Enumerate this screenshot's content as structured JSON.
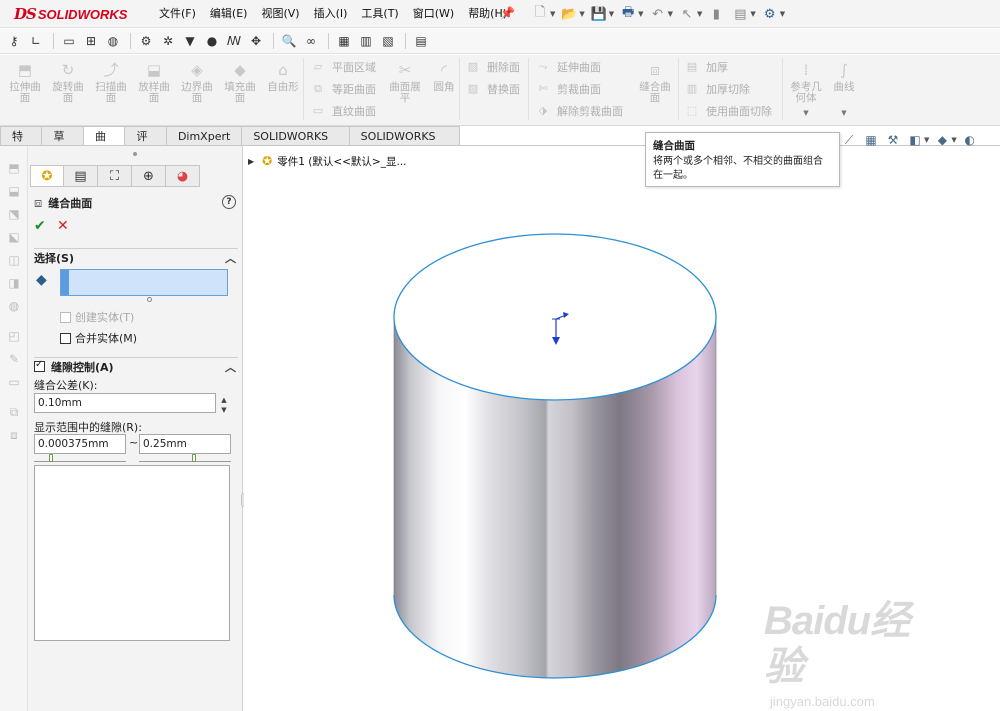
{
  "app": {
    "logo_ds": "DS",
    "logo_text": "SOLIDWORKS"
  },
  "menu": {
    "items": [
      "文件(F)",
      "编辑(E)",
      "视图(V)",
      "插入(I)",
      "工具(T)",
      "窗口(W)",
      "帮助(H)"
    ]
  },
  "ribbon": {
    "left_buttons": [
      {
        "label": "拉伸曲\n面",
        "icon": "extrude-surface-icon"
      },
      {
        "label": "旋转曲\n面",
        "icon": "revolve-surface-icon"
      },
      {
        "label": "扫描曲\n面",
        "icon": "sweep-surface-icon"
      },
      {
        "label": "放样曲\n面",
        "icon": "loft-surface-icon"
      },
      {
        "label": "边界曲\n面",
        "icon": "boundary-surface-icon"
      },
      {
        "label": "填充曲\n面",
        "icon": "fill-surface-icon"
      },
      {
        "label": "自由形",
        "icon": "freeform-icon"
      }
    ],
    "plane_group": [
      "平面区域",
      "等距曲面",
      "直纹曲面"
    ],
    "flatten_label": "曲面展\n平",
    "fillet_label": "圆角",
    "face_group": [
      "删除面",
      "替换面"
    ],
    "trim_group": [
      "延伸曲面",
      "剪裁曲面",
      "解除剪裁曲面"
    ],
    "knit_label": "缝合曲\n面",
    "thicken_group": [
      "加厚",
      "加厚切除",
      "使用曲面切除"
    ],
    "ref_label": "参考几\n何体",
    "curve_label": "曲线"
  },
  "tabs": [
    "特征",
    "草图",
    "曲面",
    "评估",
    "DimXpert",
    "SOLIDWORKS 插件",
    "SOLIDWORKS MBD"
  ],
  "active_tab": "曲面",
  "tooltip": {
    "title": "缝合曲面",
    "body": "将两个或多个相邻、不相交的曲面组合在一起。"
  },
  "property_manager": {
    "title": "缝合曲面",
    "selection": {
      "header": "选择(S)",
      "create_solid": "创建实体(T)",
      "merge_entities": "合并实体(M)"
    },
    "gap_control": {
      "header": "缝隙控制(A)",
      "tolerance_label": "缝合公差(K):",
      "tolerance_value": "0.10mm",
      "range_label": "显示范围中的缝隙(R):",
      "range_min": "0.000375mm",
      "range_separator": "~",
      "range_max": "0.25mm"
    }
  },
  "tree": {
    "node_label": "零件1  (默认<<默认>_显..."
  },
  "watermark": {
    "main": "Baidu经验",
    "sub": "jingyan.baidu.com"
  },
  "colors": {
    "brand_red": "#d6001c",
    "selection_blue": "#cfe4fa",
    "edge_blue": "#2d8fd5"
  }
}
